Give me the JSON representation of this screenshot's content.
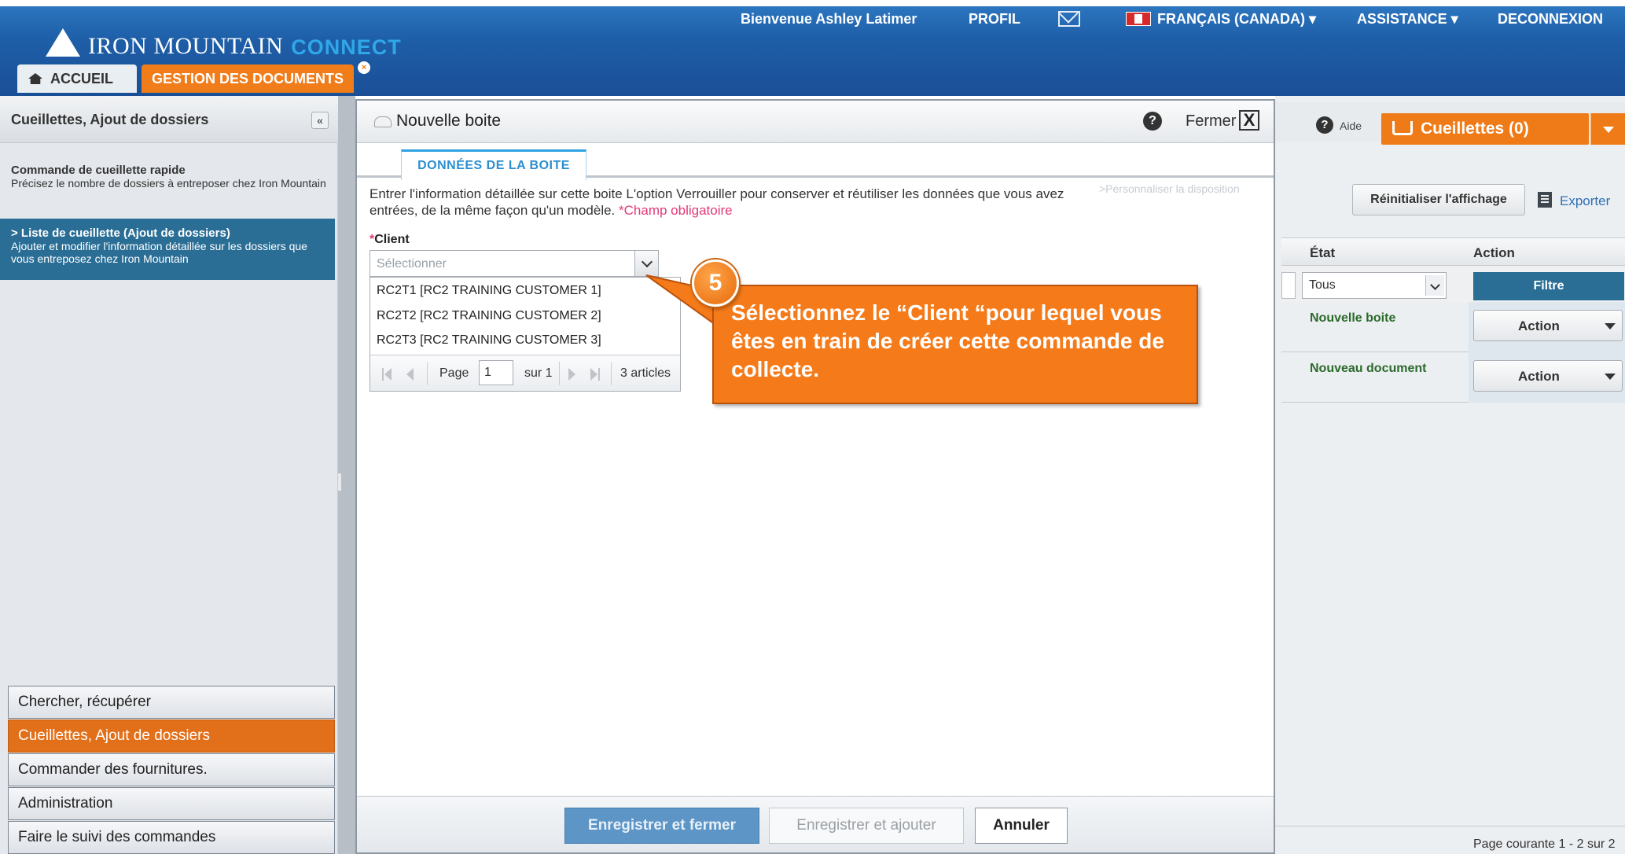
{
  "header": {
    "brand": "IRON MOUNTAIN",
    "brand_suffix": "CONNECT",
    "welcome": "Bienvenue Ashley Latimer",
    "profile": "PROFIL",
    "language": "FRANÇAIS (CANADA) ▾",
    "assistance": "ASSISTANCE ▾",
    "logout": "DECONNEXION",
    "tabs": [
      {
        "label": "ACCUEIL"
      },
      {
        "label": "GESTION DES DOCUMENTS"
      }
    ]
  },
  "sidebar": {
    "title": "Cueillettes, Ajout de dossiers",
    "collapse": "«",
    "item_quick_title": "Commande de cueillette rapide",
    "item_quick_desc": "Précisez le nombre de dossiers à entreposer chez Iron Mountain",
    "item_list_title": "> Liste de cueillette (Ajout de dossiers)",
    "item_list_desc": "Ajouter et modifier l'information détaillée sur les dossiers que vous entreposez chez Iron Mountain",
    "nav": [
      {
        "label": "Chercher, récupérer"
      },
      {
        "label": "Cueillettes, Ajout de dossiers"
      },
      {
        "label": "Commander des fournitures."
      },
      {
        "label": "Administration"
      },
      {
        "label": "Faire le suivi des commandes"
      }
    ]
  },
  "right": {
    "help_icon": "?",
    "help": "Aide",
    "cart": "Cueillettes (0)",
    "reset": "Réinitialiser l'affichage",
    "export": "Exporter",
    "col_state": "État",
    "col_action": "Action",
    "filter_value": "Tous",
    "filter_button": "Filtre",
    "rows": [
      {
        "state": "Nouvelle boite",
        "action": "Action"
      },
      {
        "state": "Nouveau document",
        "action": "Action"
      }
    ],
    "page_info": "Page courante 1 - 2 sur 2"
  },
  "modal": {
    "title": "Nouvelle boite",
    "help_icon": "?",
    "close": "Fermer",
    "close_x": "X",
    "tab": "DONNÉES DE LA BOITE",
    "description": "Entrer l'information détaillée sur cette boite L'option Verrouiller pour conserver et réutiliser les données que vous avez entrées, de la même façon qu'un modèle.",
    "required_note": "*Champ obligatoire",
    "customize": ">Personnaliser la disposition",
    "client_star": "*",
    "client_label": "Client",
    "client_placeholder": "Sélectionner",
    "options": [
      "RC2T1 [RC2 TRAINING CUSTOMER 1]",
      "RC2T2 [RC2 TRAINING CUSTOMER 2]",
      "RC2T3 [RC2 TRAINING CUSTOMER 3]"
    ],
    "pager": {
      "page_label": "Page",
      "page_value": "1",
      "of": "sur 1",
      "count": "3 articles"
    },
    "buttons": {
      "save_close": "Enregistrer et fermer",
      "save_add": "Enregistrer et ajouter",
      "cancel": "Annuler"
    }
  },
  "callout": {
    "step": "5",
    "text": "Sélectionnez le “Client “pour lequel vous êtes en train de créer cette commande de collecte."
  },
  "colors": {
    "brand_blue": "#1e5fa8",
    "accent_orange": "#f07c1a",
    "selected_blue": "#2a6e96"
  }
}
